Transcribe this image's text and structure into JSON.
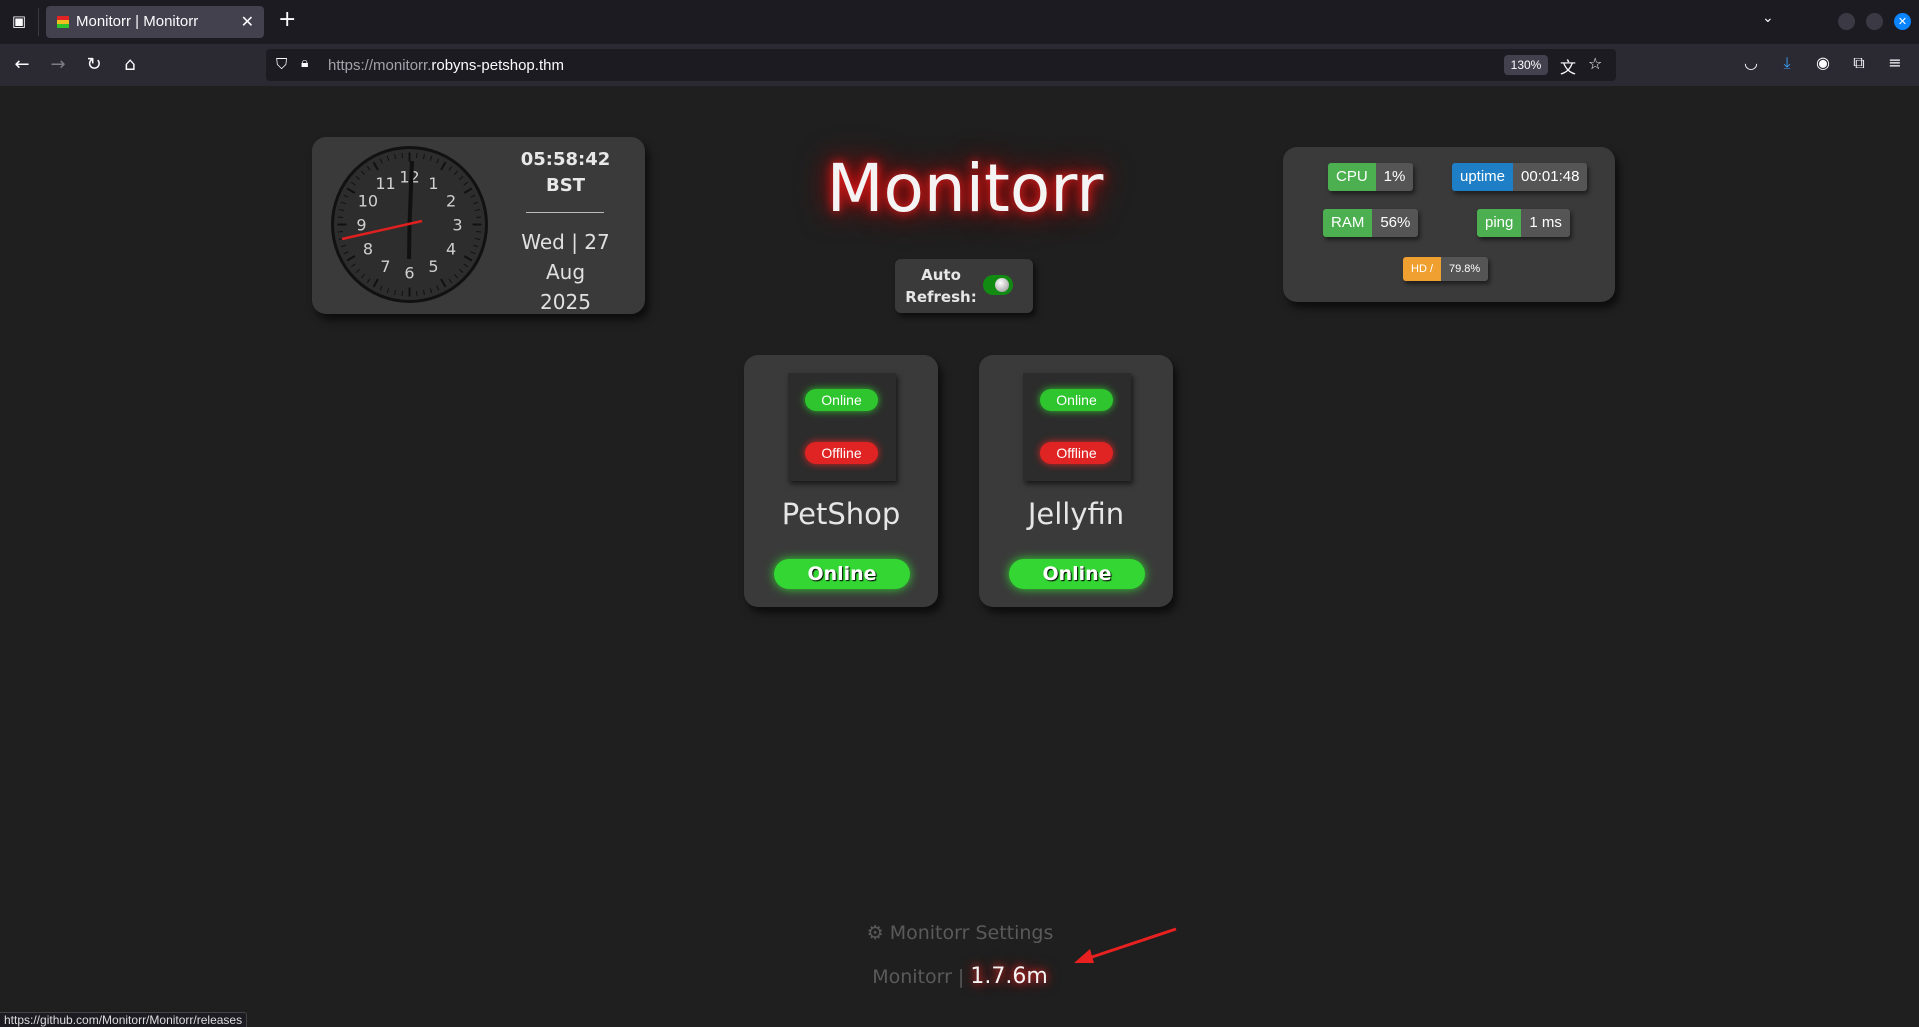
{
  "browser": {
    "tab_title": "Monitorr | Monitorr",
    "url_prefix": "https://monitorr.",
    "url_domain": "robyns-petshop.thm",
    "zoom": "130%",
    "status_link": "https://github.com/Monitorr/Monitorr/releases"
  },
  "clock": {
    "time": "05:58:42",
    "tz": "BST",
    "date_line1": "Wed | 27",
    "date_line2": "Aug",
    "date_line3": "2025",
    "numerals": [
      "12",
      "1",
      "2",
      "3",
      "4",
      "5",
      "6",
      "7",
      "8",
      "9",
      "10",
      "11"
    ]
  },
  "header": {
    "logo": "Monitorr"
  },
  "autorefresh": {
    "label_line1": "Auto",
    "label_line2": "Refresh:",
    "enabled": true
  },
  "stats": {
    "cpu": {
      "label": "CPU",
      "value": "1%"
    },
    "uptime": {
      "label": "uptime",
      "value": "00:01:48"
    },
    "ram": {
      "label": "RAM",
      "value": "56%"
    },
    "ping": {
      "label": "ping",
      "value": "1 ms"
    },
    "hd": {
      "label": "HD /",
      "value": "79.8%"
    }
  },
  "services": [
    {
      "name": "PetShop",
      "online_label": "Online",
      "offline_label": "Offline",
      "status": "Online"
    },
    {
      "name": "Jellyfin",
      "online_label": "Online",
      "offline_label": "Offline",
      "status": "Online"
    }
  ],
  "footer": {
    "settings_label": "Monitorr Settings",
    "brand": "Monitorr |",
    "version": "1.7.6m"
  },
  "colors": {
    "online": "#33d633",
    "offline": "#e02424",
    "accent_glow": "#ff2222"
  }
}
